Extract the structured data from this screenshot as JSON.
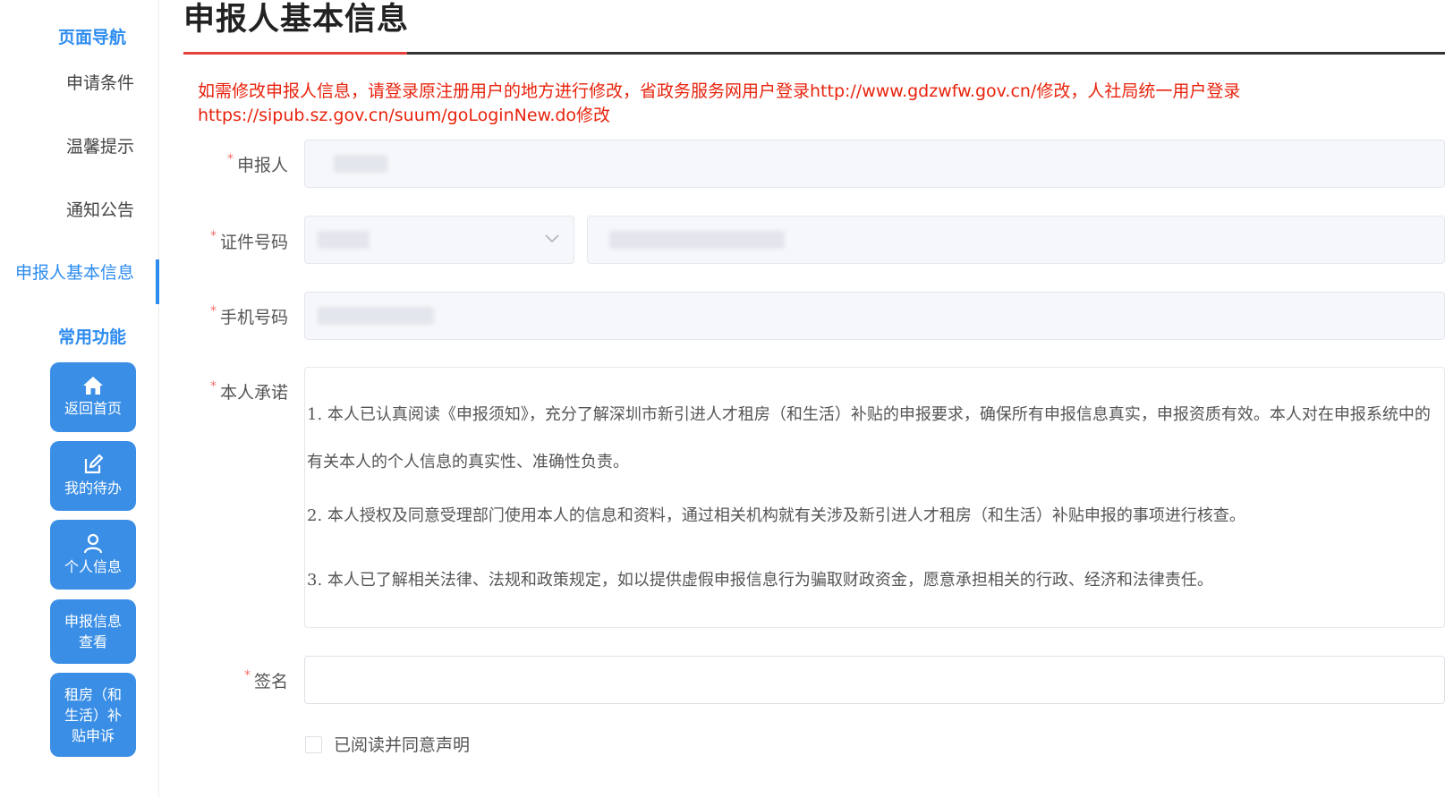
{
  "sidebar": {
    "nav_heading": "页面导航",
    "nav_items": [
      {
        "label": "申请条件"
      },
      {
        "label": "温馨提示"
      },
      {
        "label": "通知公告"
      },
      {
        "label": "申报人基本信息",
        "active": true
      }
    ],
    "functions_heading": "常用功能",
    "functions": [
      {
        "label": "返回首页",
        "icon": "home-icon"
      },
      {
        "label": "我的待办",
        "icon": "edit-icon"
      },
      {
        "label": "个人信息",
        "icon": "user-icon"
      },
      {
        "label": "申报信息查看"
      },
      {
        "label": "租房（和生活）补贴申诉"
      }
    ]
  },
  "main": {
    "title": "申报人基本信息",
    "notice": "如需修改申报人信息，请登录原注册用户的地方进行修改，省政务服务网用户登录http://www.gdzwfw.gov.cn/修改，人社局统一用户登录https://sipub.sz.gov.cn/suum/goLoginNew.do修改",
    "form": {
      "applicant_label": "申报人",
      "id_number_label": "证件号码",
      "phone_label": "手机号码",
      "commitment_label": "本人承诺",
      "commitment_items": [
        "1. 本人已认真阅读《申报须知》，充分了解深圳市新引进人才租房（和生活）补贴的申报要求，确保所有申报信息真实，申报资质有效。本人对在申报系统中的有关本人的个人信息的真实性、准确性负责。",
        "2. 本人授权及同意受理部门使用本人的信息和资料，通过相关机构就有关涉及新引进人才租房（和生活）补贴申报的事项进行核查。",
        "3. 本人已了解相关法律、法规和政策规定，如以提供虚假申报信息行为骗取财政资金，愿意承担相关的行政、经济和法律责任。"
      ],
      "signature_label": "签名",
      "agree_label": "已阅读并同意声明",
      "required_mark": "*"
    }
  },
  "colors": {
    "accent": "#2d8cf0",
    "button": "#3a8ee6",
    "notice": "#e8230d",
    "title_accent": "#e6403a"
  }
}
